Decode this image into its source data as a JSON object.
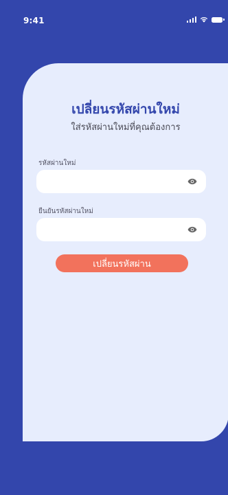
{
  "status_bar": {
    "time": "9:41",
    "icons": [
      "signal-icon",
      "wifi-icon",
      "battery-icon"
    ]
  },
  "header": {
    "title": "เปลี่ยนรหัสผ่านใหม่",
    "subtitle": "ใส่รหัสผ่านใหม่ที่คุณต้องการ"
  },
  "form": {
    "new_password": {
      "label": "รหัสผ่านใหม่",
      "value": "",
      "placeholder": ""
    },
    "confirm_password": {
      "label": "ยืนยันรหัสผ่านใหม่",
      "value": "",
      "placeholder": ""
    },
    "submit_label": "เปลี่ยนรหัสผ่าน"
  },
  "colors": {
    "background": "#3346ac",
    "card": "#e7edfd",
    "title": "#3346ac",
    "button": "#f2725c"
  }
}
